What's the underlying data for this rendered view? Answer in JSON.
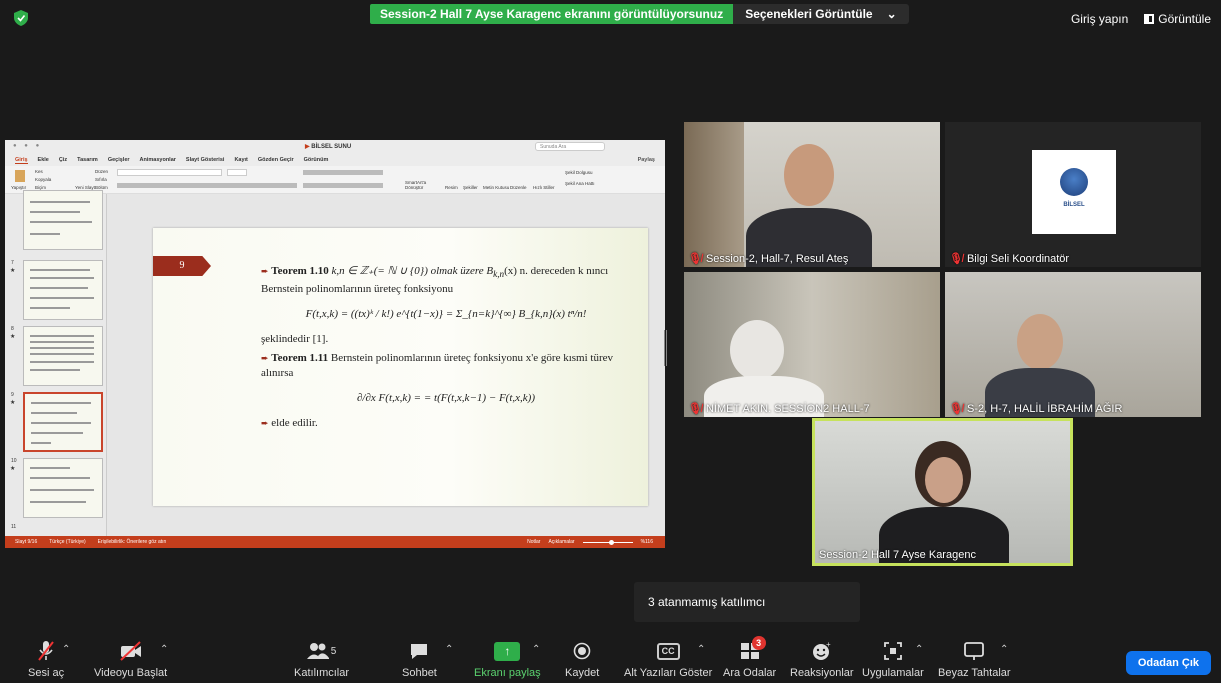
{
  "top_bar": {
    "sharing_notice": "Session-2 Hall 7 Ayse Karagenc ekranını görüntülüyorsunuz",
    "view_options_label": "Seçenekleri Görüntüle",
    "view_options_caret": "⌄",
    "sign_in": "Giriş yapın",
    "view_label": "Görüntüle"
  },
  "shared_screen": {
    "window_controls": "● ● ●",
    "doc_title": "BİLSEL SUNU",
    "search_placeholder": "Sunuda Ara",
    "tabs": [
      "Giriş",
      "Ekle",
      "Çiz",
      "Tasarım",
      "Geçişler",
      "Animasyonlar",
      "Slayt Gösterisi",
      "Kayıt",
      "Gözden Geçir",
      "Görünüm"
    ],
    "share_button": "Paylaş",
    "ribbon": {
      "paste": "Yapıştır",
      "cut": "Kes",
      "copy": "Kopyala",
      "format": "Biçim",
      "new_slide": "Yeni Slayt",
      "layout": "Düzen",
      "reset": "Sıfırla",
      "section": "Bölüm",
      "smartart": "SmartArt'a Dönüştür",
      "picture": "Resim",
      "shapes": "Şekiller",
      "textbox": "Metin Kutusu",
      "arrange": "Düzenle",
      "quick_styles": "Hızlı Stiller",
      "shape_fill": "Şekil Dolgusu",
      "shape_outline": "Şekil Ana Hattı"
    },
    "thumbnails": [
      {
        "num": "7"
      },
      {
        "num": "8"
      },
      {
        "num": "9"
      },
      {
        "num": "10"
      },
      {
        "num": "11"
      }
    ],
    "slide": {
      "number": "9",
      "theorem1_head": "Teorem 1.10",
      "theorem1_text": " k,n ∈ ℤ₊(= ℕ ∪ {0}) olmak üzere B",
      "theorem1_sub": "k,n",
      "theorem1_rest": "(x) n. dereceden k nıncı Bernstein polinomlarının üreteç fonksiyonu",
      "formula1": "F(t,x,k) = ((tx)ᵏ / k!) e^{t(1−x)} = Σ_{n=k}^{∞} B_{k,n}(x) tⁿ/n!",
      "line_after": "şeklindedir [1].",
      "theorem2_head": "Teorem 1.11",
      "theorem2_text": " Bernstein polinomlarının üreteç fonksiyonu x'e göre kısmi türev alınırsa",
      "formula2": "∂/∂x F(t,x,k) = = t(F(t,x,k−1) − F(t,x,k))",
      "conclusion": "elde edilir."
    },
    "status": {
      "slide_count": "Slayt 9/16",
      "language": "Türkçe (Türkiye)",
      "accessibility": "Erişilebilirlik: Önerilere göz atın",
      "notes": "Notlar",
      "comments": "Açıklamalar",
      "zoom": "%116"
    }
  },
  "participants": [
    {
      "name": "Session-2, Hall-7, Resul Ateş"
    },
    {
      "name": "Bilgi Seli Koordinatör",
      "logo_text": "BİLSEL"
    },
    {
      "name": "NİMET AKIN. SESSİON2 HALL-7"
    },
    {
      "name": "S-2, H-7, HALİL İBRAHİM AĞIR"
    },
    {
      "name": "Session-2 Hall 7 Ayse Karagenc"
    }
  ],
  "tooltip": "3 atanmamış katılımcı",
  "toolbar": {
    "mute": "Sesi aç",
    "video": "Videoyu Başlat",
    "participants": "Katılımcılar",
    "participants_count": "5",
    "chat": "Sohbet",
    "share": "Ekranı paylaş",
    "record": "Kaydet",
    "captions": "Alt Yazıları Göster",
    "cc_glyph": "CC",
    "breakout": "Ara Odalar",
    "breakout_badge": "3",
    "reactions": "Reaksiyonlar",
    "apps": "Uygulamalar",
    "whiteboard": "Beyaz Tahtalar",
    "leave": "Odadan Çık"
  },
  "colors": {
    "share_green": "#2fae4a",
    "leave_blue": "#0e72ed",
    "active_speaker": "#c6e25c",
    "ppt_accent": "#c43e1c",
    "muted_red": "#e33333"
  }
}
